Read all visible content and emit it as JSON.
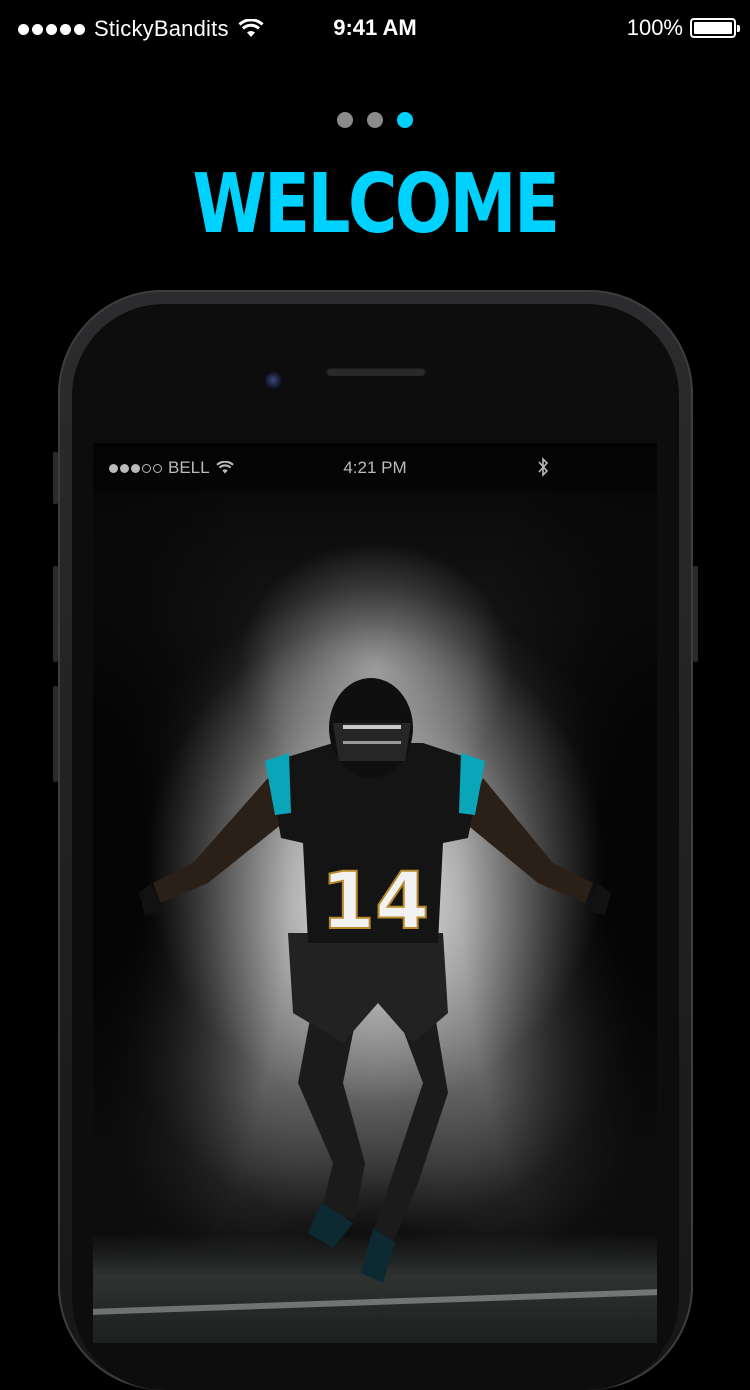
{
  "status_bar": {
    "carrier": "StickyBandits",
    "time": "9:41 AM",
    "battery_percent": "100%",
    "signal_bars": 5,
    "battery_level": 1.0
  },
  "pager": {
    "total": 3,
    "active_index": 2
  },
  "title": "WELCOME",
  "device_screen": {
    "carrier": "BELL",
    "time": "4:21 PM",
    "signal_bars": 3,
    "signal_max": 5,
    "jersey_number": "14"
  },
  "colors": {
    "accent": "#00d2ff",
    "background": "#000000",
    "pager_inactive": "#8b8b8b"
  }
}
